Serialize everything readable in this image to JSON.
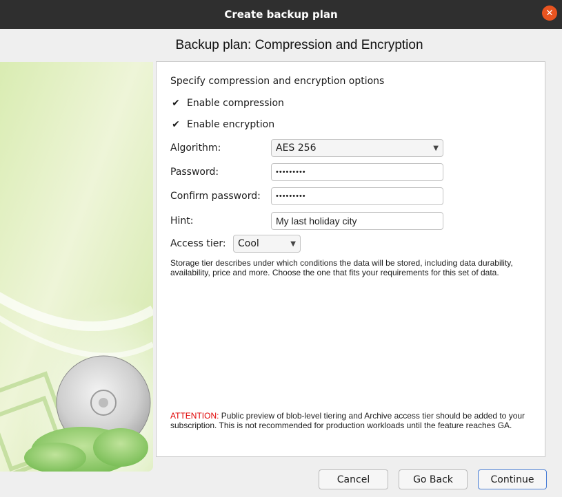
{
  "window": {
    "title": "Create backup plan",
    "close_glyph": "✕"
  },
  "page": {
    "heading": "Backup plan: Compression and Encryption"
  },
  "form": {
    "intro": "Specify compression and encryption options",
    "enable_compression": {
      "label": "Enable compression",
      "checked": true,
      "mark": "✔"
    },
    "enable_encryption": {
      "label": "Enable encryption",
      "checked": true,
      "mark": "✔"
    },
    "algorithm": {
      "label": "Algorithm:",
      "value": "AES 256"
    },
    "password": {
      "label": "Password:",
      "value": "•••••••••"
    },
    "confirm_password": {
      "label": "Confirm password:",
      "value": "•••••••••"
    },
    "hint": {
      "label": "Hint:",
      "value": "My last holiday city"
    },
    "access_tier": {
      "label": "Access tier:",
      "value": "Cool"
    },
    "caret": "▼",
    "tier_description": "Storage tier describes under which conditions the data will be stored, including data durability, availability, price and more. Choose the one that fits your requirements for this set of data.",
    "attention_prefix": "ATTENTION:",
    "attention_text": " Public preview of blob-level tiering and Archive access tier should be added to your subscription. This is not recommended for production workloads until the feature reaches GA."
  },
  "buttons": {
    "cancel": "Cancel",
    "go_back": "Go Back",
    "continue": "Continue"
  },
  "colors": {
    "titlebar": "#2f2f2f",
    "close": "#e95420",
    "attention": "#e00000",
    "accent_border": "#4a7fd6"
  },
  "icons": {
    "side_art": "backup-disc-illustration"
  }
}
